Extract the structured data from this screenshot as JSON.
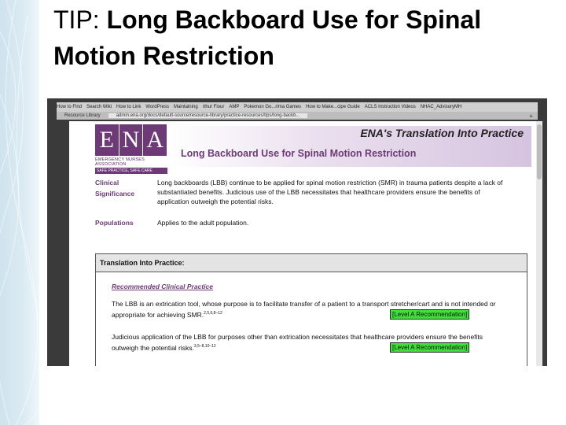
{
  "slide": {
    "title_prefix": "TIP:  ",
    "title_bold": "Long Backboard Use for Spinal Motion Restriction"
  },
  "browser": {
    "bookmarks": [
      "How to Find",
      "Search Wiki",
      "How to Link",
      "WordPress",
      "Maintaining",
      "rthur Flour",
      "AMP",
      "Pokemon Go...rima Games",
      "How to Make...cipe Guide",
      "ACLS Instruction Videos",
      "NHAC_AdvisoryMH"
    ],
    "tabs": [
      "Resource Library",
      "admin.ena.org/docs/default-source/resource-library/practice-resources/tips/long-backb..."
    ],
    "new_tab": "+"
  },
  "document": {
    "logo_letters": [
      "E",
      "N",
      "A"
    ],
    "logo_org": "EMERGENCY NURSES ASSOCIATION",
    "logo_tagline": "SAFE PRACTICE, SAFE CARE",
    "header_right": "ENA's Translation Into Practice",
    "title": "Long Backboard Use for Spinal Motion Restriction",
    "clinical_label_1": "Clinical",
    "clinical_label_2": "Significance",
    "clinical_text": "Long backboards (LBB) continue to be applied for spinal motion restriction (SMR) in trauma patients despite a lack of substantiated benefits. Judicious use of the LBB necessitates that healthcare providers ensure the benefits of application outweigh the potential risks.",
    "populations_label": "Populations",
    "populations_text": "Applies to the adult population.",
    "box_header": "Translation Into Practice:",
    "rec_heading": "Recommended Clinical Practice",
    "rec1_text": "The LBB is an extrication tool, whose purpose is to facilitate transfer of a patient to a transport stretcher/cart and is not intended or appropriate for achieving SMR.",
    "rec1_refs": "2,5,6,8–12",
    "rec1_badge": "[Level A Recommendation]",
    "rec2_text": "Judicious application of the LBB for purposes other than extrication necessitates that healthcare providers ensure the benefits outweigh the potential risks.",
    "rec2_refs": "3,5–8,10–12",
    "rec2_badge": "[Level A Recommendation]"
  },
  "colors": {
    "ena_purple": "#6d3a77",
    "badge_green": "#3ee039"
  }
}
